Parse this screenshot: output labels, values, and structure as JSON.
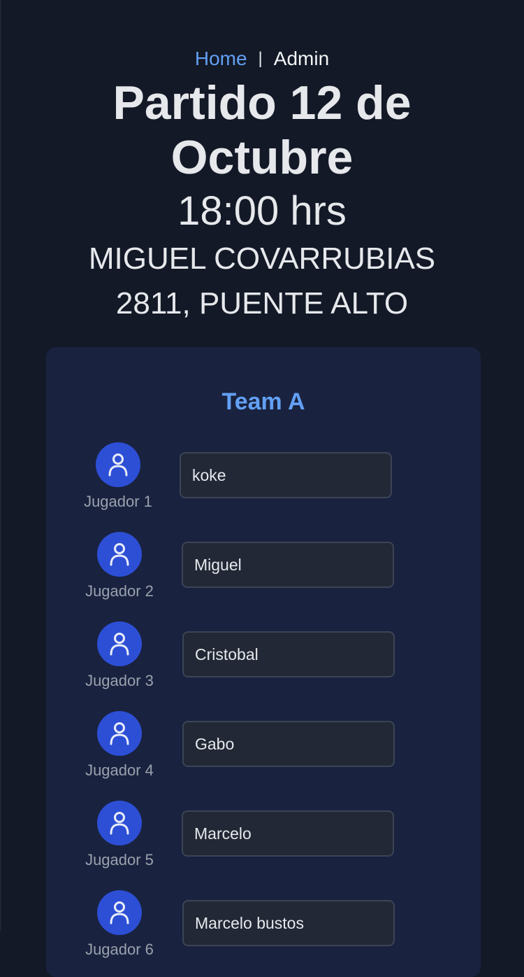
{
  "nav": {
    "home_label": "Home",
    "separator": "|",
    "admin_label": "Admin"
  },
  "match": {
    "title": "Partido 12 de Octubre",
    "time": "18:00 hrs",
    "address": "MIGUEL COVARRUBIAS 2811, PUENTE ALTO"
  },
  "team": {
    "name": "Team A",
    "players": [
      {
        "label": "Jugador 1",
        "value": "koke"
      },
      {
        "label": "Jugador 2",
        "value": "Miguel"
      },
      {
        "label": "Jugador 3",
        "value": "Cristobal"
      },
      {
        "label": "Jugador 4",
        "value": "Gabo"
      },
      {
        "label": "Jugador 5",
        "value": "Marcelo"
      },
      {
        "label": "Jugador 6",
        "value": "Marcelo bustos"
      }
    ]
  },
  "colors": {
    "background": "#131926",
    "card": "#19223f",
    "accent": "#62a0f4",
    "avatar": "#2d4fd6",
    "input_bg": "#222835"
  }
}
